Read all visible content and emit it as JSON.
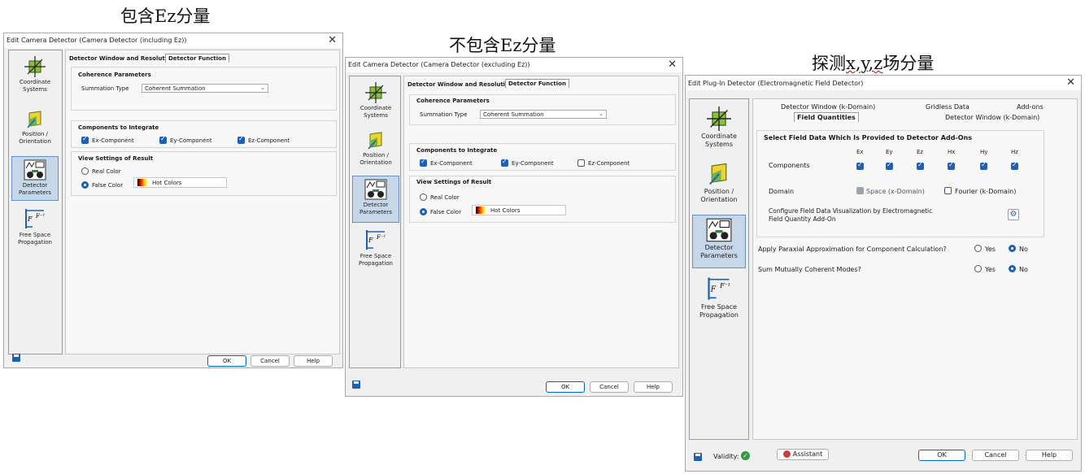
{
  "captions": {
    "including": "包含Ez分量",
    "excluding": "不包含Ez分量",
    "xyz_prefix": "探测",
    "xyz_u": "x,y,z",
    "xyz_suffix": "场分量"
  },
  "sidebar_items": {
    "coordinate": "Coordinate Systems",
    "position": "Position / Orientation",
    "detector": "Detector Parameters",
    "freespace": "Free Space Propagation"
  },
  "win1": {
    "title": "Edit Camera Detector (Camera Detector (including Ez))",
    "tab_window": "Detector Window and Resolution",
    "tab_function": "Detector Function",
    "coherence_title": "Coherence Parameters",
    "summation_label": "Summation Type",
    "summation_value": "Coherent Summation",
    "components_title": "Components to Integrate",
    "ex": "Ex-Component",
    "ey": "Ey-Component",
    "ez": "Ez-Component",
    "view_title": "View Settings of Result",
    "real_color": "Real Color",
    "false_color": "False Color",
    "colormap": "Hot Colors",
    "ok": "OK",
    "cancel": "Cancel",
    "help": "Help"
  },
  "win2": {
    "title": "Edit Camera Detector (Camera Detector (excluding Ez))",
    "tab_window": "Detector Window and Resolution",
    "tab_function": "Detector Function",
    "coherence_title": "Coherence Parameters",
    "summation_label": "Summation Type",
    "summation_value": "Coherent Summation",
    "components_title": "Components to Integrate",
    "ex": "Ex-Component",
    "ey": "Ey-Component",
    "ez": "Ez-Component",
    "view_title": "View Settings of Result",
    "real_color": "Real Color",
    "false_color": "False Color",
    "colormap": "Hot Colors",
    "ok": "OK",
    "cancel": "Cancel",
    "help": "Help"
  },
  "win3": {
    "title": "Edit Plug-In Detector (Electromagnetic Field Detector)",
    "tab_window_k": "Detector Window (k-Domain)",
    "tab_gridless": "Gridless Data",
    "tab_addons": "Add-ons",
    "tab_field": "Field Quantities",
    "tab_window_k2": "Detector Window (k-Domain)",
    "select_title": "Select Field Data Which Is Provided to Detector Add-Ons",
    "components_label": "Components",
    "comp_headers": [
      "Ex",
      "Ey",
      "Ez",
      "Hx",
      "Hy",
      "Hz"
    ],
    "domain_label": "Domain",
    "space_domain": "Space (x-Domain)",
    "fourier_domain": "Fourier (k-Domain)",
    "configure_text": "Configure Field Data Visualization by Electromagnetic Field Quantity Add-On",
    "paraxial_q": "Apply Paraxial Approximation for Component Calculation?",
    "coherent_q": "Sum Mutually Coherent Modes?",
    "yes": "Yes",
    "no": "No",
    "validity": "Validity:",
    "assistant": "Assistant",
    "ok": "OK",
    "cancel": "Cancel",
    "help": "Help"
  }
}
